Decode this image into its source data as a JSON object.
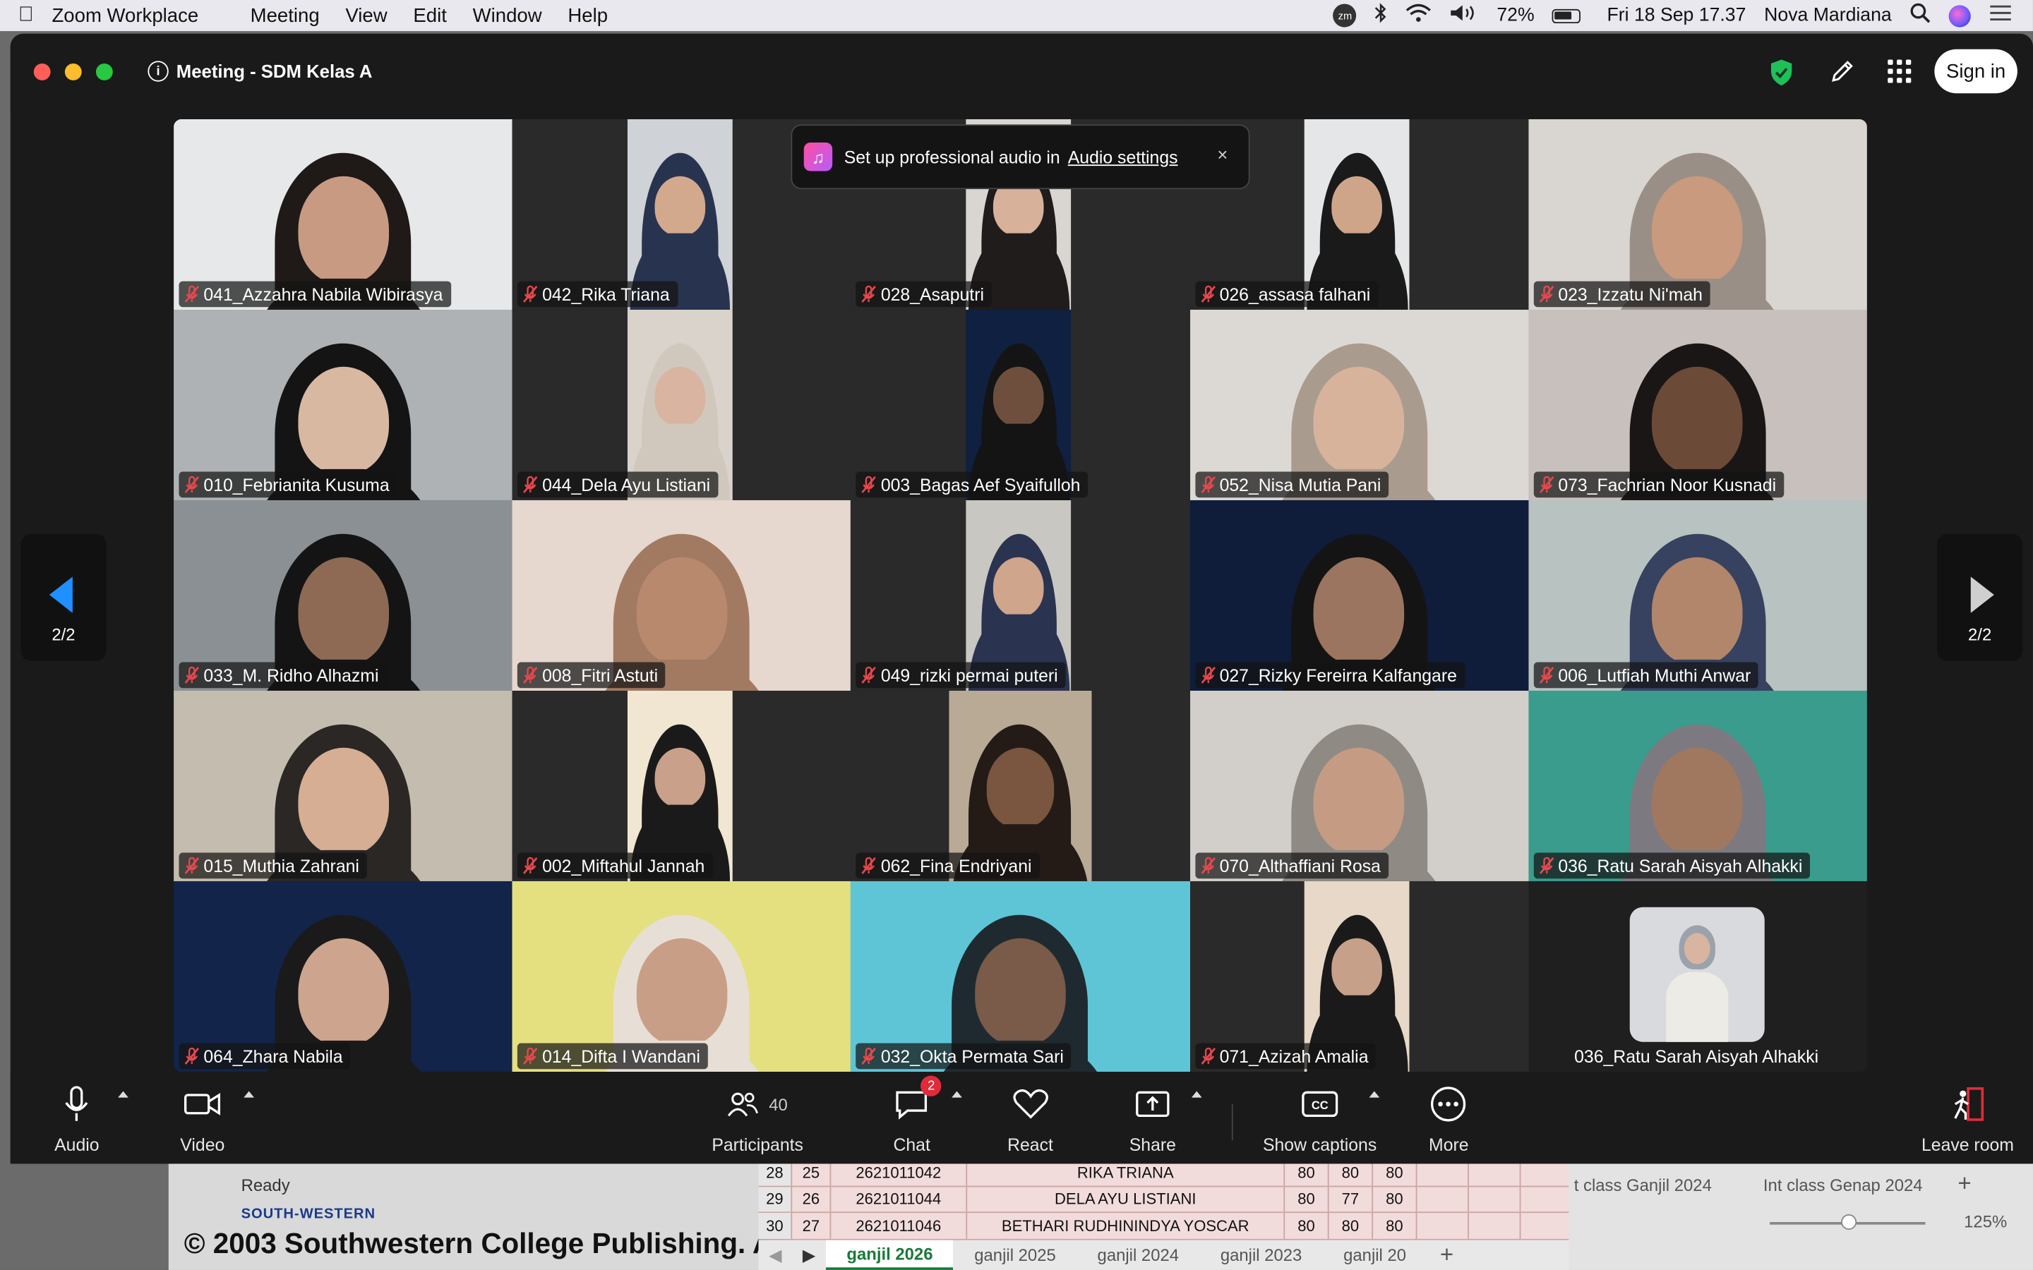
{
  "menubar": {
    "app": "Zoom Workplace",
    "menus": [
      "Meeting",
      "View",
      "Edit",
      "Window",
      "Help"
    ],
    "zm": "zm",
    "battery": "72%",
    "datetime": "Fri 18 Sep  17.37",
    "user": "Nova Mardiana"
  },
  "background_doc": {
    "status": "Ready",
    "brand": "SOUTH-WESTERN",
    "copyright": "© 2003 Southwestern College Publishing. A",
    "rows": [
      {
        "r": "28",
        "no": "25",
        "id": "2621011042",
        "name": "RIKA TRIANA",
        "v1": "80",
        "v2": "80",
        "v3": "80"
      },
      {
        "r": "29",
        "no": "26",
        "id": "2621011044",
        "name": "DELA AYU LISTIANI",
        "v1": "80",
        "v2": "77",
        "v3": "80"
      },
      {
        "r": "30",
        "no": "27",
        "id": "2621011046",
        "name": "BETHARI RUDHININDYA YOSCAR",
        "v1": "80",
        "v2": "80",
        "v3": "80"
      }
    ],
    "sheet_tabs": [
      "ganjil 2026",
      "ganjil 2025",
      "ganjil 2024",
      "ganjil 2023",
      "ganjil 20"
    ],
    "right_tabs": [
      "t class Ganjil 2024",
      "Int class Genap 2024"
    ],
    "zoom": "125%"
  },
  "window": {
    "title": "Meeting - SDM Kelas A",
    "sign_in": "Sign in"
  },
  "toast": {
    "text": "Set up professional audio in",
    "link": "Audio settings",
    "close": "×"
  },
  "pager": {
    "left": "2/2",
    "right": "2/2"
  },
  "participants": [
    "041_Azzahra Nabila Wibirasya",
    "042_Rika Triana",
    "028_Asaputri",
    "026_assasa falhani",
    "023_Izzatu Ni'mah",
    "010_Febrianita Kusuma",
    "044_Dela Ayu Listiani",
    "003_Bagas Aef Syaifulloh",
    "052_Nisa Mutia Pani",
    "073_Fachrian Noor Kusnadi",
    "033_M. Ridho Alhazmi",
    "008_Fitri Astuti",
    "049_rizki permai puteri",
    "027_Rizky Fereirra Kalfangare",
    "006_Lutfiah Muthi Anwar",
    "015_Muthia Zahrani",
    "002_Miftahul Jannah",
    "062_Fina Endriyani",
    "070_Althaffiani Rosa",
    "036_Ratu Sarah Aisyah Alhakki",
    "064_Zhara Nabila",
    "014_Difta I Wandani",
    "032_Okta Permata Sari",
    "071_Azizah Amalia",
    "036_Ratu Sarah Aisyah Alhakki"
  ],
  "toolbar": {
    "audio": "Audio",
    "video": "Video",
    "participants": "Participants",
    "participant_count": "40",
    "chat": "Chat",
    "chat_badge": "2",
    "react": "React",
    "share": "Share",
    "captions": "Show captions",
    "more": "More",
    "leave": "Leave room"
  }
}
